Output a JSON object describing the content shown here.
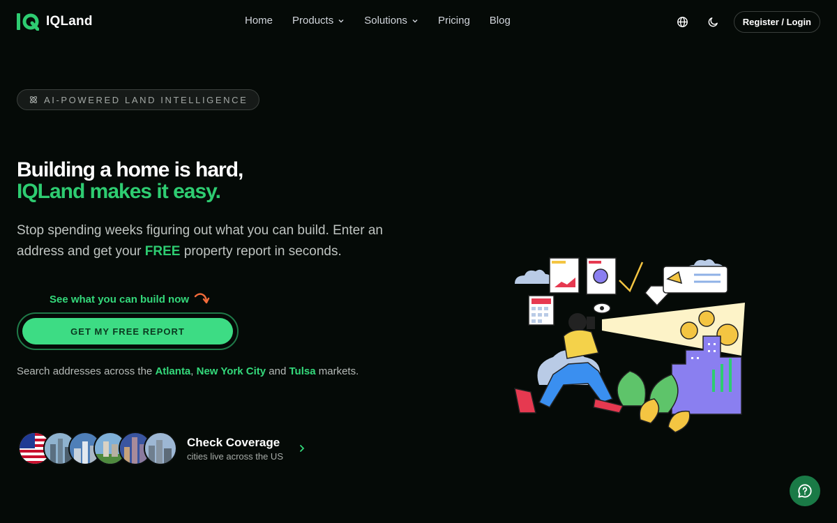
{
  "nav": {
    "brand": "IQLand",
    "menu": [
      {
        "label": "Home",
        "dropdown": false
      },
      {
        "label": "Products",
        "dropdown": true
      },
      {
        "label": "Solutions",
        "dropdown": true
      },
      {
        "label": "Pricing",
        "dropdown": false
      },
      {
        "label": "Blog",
        "dropdown": false
      }
    ],
    "register_label": "Register / Login"
  },
  "hero": {
    "badge": "AI-POWERED LAND INTELLIGENCE",
    "headline_line1": "Building a home is hard,",
    "headline_line2": "IQLand makes it easy.",
    "sub_part1": "Stop spending weeks figuring out what you can build. Enter an address and get your ",
    "sub_free": "FREE",
    "sub_part2": " property report in seconds.",
    "see_label": "See what you can build now",
    "cta_label": "GET MY FREE REPORT",
    "markets_prefix": "Search addresses across the ",
    "city1": "Atlanta",
    "sep1": ", ",
    "city2": "New York City",
    "sep2": " and ",
    "city3": "Tulsa",
    "markets_suffix": " markets."
  },
  "coverage": {
    "title": "Check Coverage",
    "subtitle": "cities live across the US"
  },
  "colors": {
    "accent": "#2ecc71",
    "background": "#050a07",
    "cta": "#3ddc84"
  }
}
